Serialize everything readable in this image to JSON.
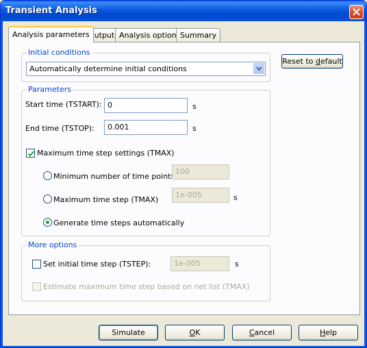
{
  "window": {
    "title": "Transient Analysis",
    "close_icon": "close-icon"
  },
  "tabs": [
    "Analysis parameters",
    "Output",
    "Analysis options",
    "Summary"
  ],
  "active_tab": "Analysis parameters",
  "initial_conditions": {
    "group_label": "Initial conditions",
    "selected": "Automatically determine initial conditions"
  },
  "reset_button": {
    "label_pre": "Reset to ",
    "label_ul": "d",
    "label_post": "efault"
  },
  "parameters": {
    "group_label": "Parameters",
    "start_label": "Start time (TSTART):",
    "start_value": "0",
    "start_unit": "s",
    "end_label": "End time (TSTOP):",
    "end_value": "0.001",
    "end_unit": "s",
    "tmax_checkbox_label": "Maximum time step settings (TMAX)",
    "tmax_checked": true,
    "radio_min_points_label": "Minimum number of time points",
    "min_points_value": "100",
    "radio_max_step_label": "Maximum time step (TMAX)",
    "max_step_value": "1e-005",
    "max_step_unit": "s",
    "radio_auto_label": "Generate time steps automatically",
    "selected_radio": "auto"
  },
  "more_options": {
    "group_label": "More options",
    "tstep_label": "Set initial time step (TSTEP):",
    "tstep_checked": false,
    "tstep_value": "1e-005",
    "tstep_unit": "s",
    "estimate_label": "Estimate maximum time step based on net list (TMAX)",
    "estimate_checked": false
  },
  "buttons": {
    "simulate": "Simulate",
    "ok_ul": "O",
    "ok_post": "K",
    "cancel_ul": "C",
    "cancel_post": "ancel",
    "help_ul": "H",
    "help_post": "elp"
  },
  "colors": {
    "title_bar": "#0a58dc",
    "group_label": "#0046d5",
    "close_button": "#d9481f",
    "check_mark": "#21a121"
  }
}
